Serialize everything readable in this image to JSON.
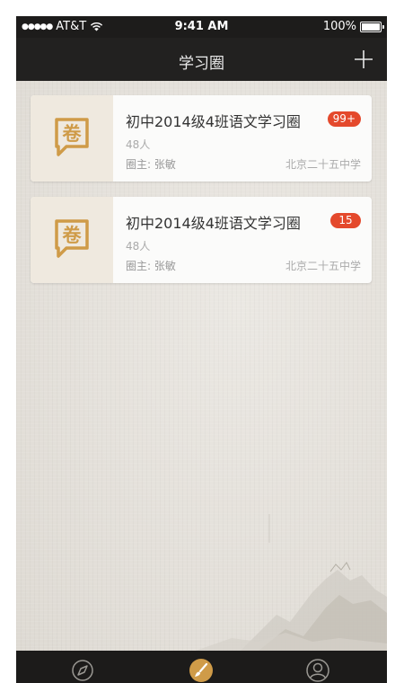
{
  "status_bar": {
    "carrier": "AT&T",
    "time": "9:41 AM",
    "battery": "100%"
  },
  "nav": {
    "title": "学习圈",
    "add_icon": "plus-icon"
  },
  "circles": [
    {
      "name": "初中2014级4班语文学习圈",
      "badge": "99+",
      "members": "48人",
      "owner": "圈主: 张敏",
      "school": "北京二十五中学",
      "icon_text": "卷"
    },
    {
      "name": "初中2014级4班语文学习圈",
      "badge": "15",
      "members": "48人",
      "owner": "圈主: 张敏",
      "school": "北京二十五中学",
      "icon_text": "卷"
    }
  ],
  "tabs": [
    {
      "icon": "compass-icon",
      "active": false
    },
    {
      "icon": "brush-icon",
      "active": true
    },
    {
      "icon": "profile-icon",
      "active": false
    }
  ],
  "colors": {
    "accent": "#cf9b48",
    "badge": "#e4492c",
    "nav_bg": "#222120",
    "content_bg": "#e5e2dd"
  }
}
